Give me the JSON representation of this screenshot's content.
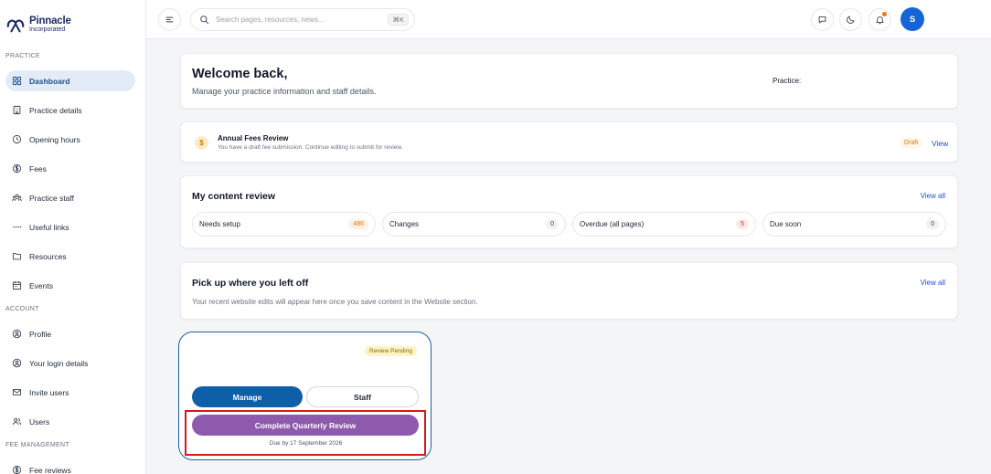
{
  "brand": {
    "name": "Pinnacle",
    "sub": "Incorporated"
  },
  "sidebar": {
    "sections": {
      "practice": "PRACTICE",
      "account": "ACCOUNT",
      "fee_management": "FEE MANAGEMENT"
    },
    "items": [
      {
        "label": "Dashboard",
        "icon": "grid-icon"
      },
      {
        "label": "Practice details",
        "icon": "building-icon"
      },
      {
        "label": "Opening hours",
        "icon": "clock-icon"
      },
      {
        "label": "Fees",
        "icon": "dollar-icon"
      },
      {
        "label": "Practice staff",
        "icon": "team-icon"
      },
      {
        "label": "Useful links",
        "icon": "dots-icon"
      },
      {
        "label": "Resources",
        "icon": "folder-icon"
      },
      {
        "label": "Events",
        "icon": "calendar-icon"
      },
      {
        "label": "Profile",
        "icon": "user-circle-icon"
      },
      {
        "label": "Your login details",
        "icon": "user-circle-icon"
      },
      {
        "label": "Invite users",
        "icon": "mail-icon"
      },
      {
        "label": "Users",
        "icon": "users-icon"
      },
      {
        "label": "Fee reviews",
        "icon": "dollar-icon"
      }
    ]
  },
  "topbar": {
    "search_placeholder": "Search pages, resources, news...",
    "shortcut": "⌘K",
    "avatar_initial": "S"
  },
  "welcome": {
    "title": "Welcome back,",
    "subtitle": "Manage your practice information and staff details.",
    "practice_label": "Practice:"
  },
  "fees_notice": {
    "title": "Annual Fees Review",
    "description": "You have a draft fee submission. Continue editing to submit for review.",
    "badge": "Draft",
    "link": "View",
    "icon_glyph": "$"
  },
  "content_review": {
    "title": "My content review",
    "view_all": "View all",
    "items": [
      {
        "label": "Needs setup",
        "count": "486"
      },
      {
        "label": "Changes",
        "count": "0"
      },
      {
        "label": "Overdue (all pages)",
        "count": "5"
      },
      {
        "label": "Due soon",
        "count": "0"
      }
    ]
  },
  "pickup": {
    "title": "Pick up where you left off",
    "view_all": "View all",
    "description": "Your recent website edits will appear here once you save content in the Website section."
  },
  "practice_card": {
    "badge": "Review Pending",
    "manage_label": "Manage",
    "staff_label": "Staff",
    "quarterly_button": "Complete Quarterly Review",
    "due_text": "Due by 17 September 2026"
  },
  "colors": {
    "accent": "#0f5fa8",
    "review_button": "#8e5aad",
    "highlight": "#d11a1a"
  }
}
